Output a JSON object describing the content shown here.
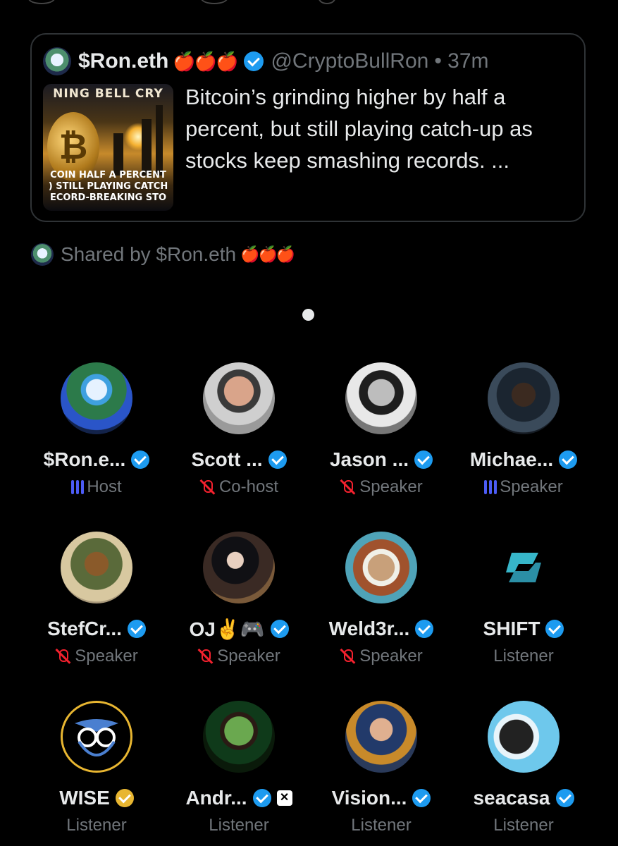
{
  "card": {
    "author_name": "$Ron.eth",
    "author_emojis": "🍎🍎🍎",
    "handle": "@CryptoBullRon",
    "time": "• 37m",
    "thumb_line1": "NING BELL CRY",
    "thumb_line2": "COIN HALF A PERCENT",
    "thumb_line3": ") STILL PLAYING CATCH",
    "thumb_line4": "ECORD-BREAKING STO",
    "text": "Bitcoin’s grinding higher by half a percent, but still playing catch-up as stocks keep smashing records. ..."
  },
  "shared": {
    "prefix": "Shared by $Ron.eth",
    "emojis": "🍎🍎🍎"
  },
  "participants": [
    {
      "name": "$Ron.e...",
      "badge": "blue",
      "role": "Host",
      "role_icon": "speaking-bars"
    },
    {
      "name": "Scott ...",
      "badge": "blue",
      "role": "Co-host",
      "role_icon": "mic-off"
    },
    {
      "name": "Jason ...",
      "badge": "blue",
      "role": "Speaker",
      "role_icon": "mic-off"
    },
    {
      "name": "Michae...",
      "badge": "blue",
      "role": "Speaker",
      "role_icon": "speaking-bars"
    },
    {
      "name": "StefCr...",
      "badge": "blue",
      "role": "Speaker",
      "role_icon": "mic-off"
    },
    {
      "name": "OJ✌️🎮",
      "badge": "blue",
      "role": "Speaker",
      "role_icon": "mic-off"
    },
    {
      "name": "Weld3r...",
      "badge": "blue",
      "role": "Speaker",
      "role_icon": "mic-off"
    },
    {
      "name": "SHIFT",
      "badge": "blue",
      "role": "Listener",
      "role_icon": "none"
    },
    {
      "name": "WISE",
      "badge": "gold",
      "role": "Listener",
      "role_icon": "none"
    },
    {
      "name": "Andr...",
      "badge": "blue",
      "role": "Listener",
      "role_icon": "none",
      "extra_icon": "affiliate-icon"
    },
    {
      "name": "Vision...",
      "badge": "blue",
      "role": "Listener",
      "role_icon": "none"
    },
    {
      "name": "seacasa",
      "badge": "blue",
      "role": "Listener",
      "role_icon": "none"
    }
  ],
  "colors": {
    "background": "#000000",
    "verified_blue": "#1d9bf0",
    "verified_gold": "#e8b631",
    "muted_red": "#f4212e",
    "speaking_bars": "#4c5cf5",
    "secondary_text": "#71767b"
  }
}
